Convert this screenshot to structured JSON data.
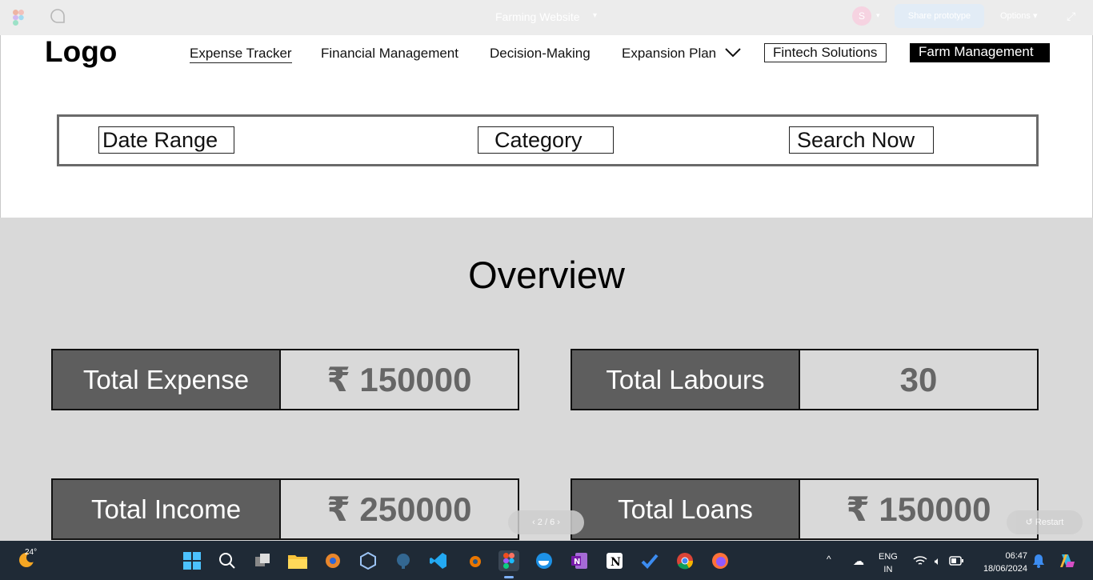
{
  "figma": {
    "file_title": "Farming Website",
    "avatar_initial": "S",
    "share_label": "Share prototype",
    "options_label": "Options",
    "page_indicator": "2 / 6",
    "restart_label": "Restart"
  },
  "header": {
    "logo": "Logo",
    "nav": {
      "expense_tracker": "Expense Tracker",
      "financial_management": "Financial Management",
      "decision_making": "Decision-Making",
      "expansion_plan": "Expansion Plan",
      "fintech_solutions": "Fintech Solutions",
      "farm_management": "Farm Management"
    }
  },
  "filters": {
    "date_range": "Date Range",
    "category": "Category",
    "search_now": "Search Now"
  },
  "overview": {
    "title": "Overview",
    "cards": [
      {
        "label": "Total Expense",
        "value": "₹ 150000"
      },
      {
        "label": "Total Labours",
        "value": "30"
      },
      {
        "label": "Total Income",
        "value": "₹ 250000"
      },
      {
        "label": "Total Loans",
        "value": "₹ 150000"
      }
    ]
  },
  "taskbar": {
    "temperature": "24°",
    "lang_line1": "ENG",
    "lang_line2": "IN",
    "time": "06:47",
    "date": "18/06/2024"
  },
  "colors": {
    "card_label_bg": "#5e5e5e",
    "section_bg": "#d9d9d9",
    "taskbar_bg": "#1f2a36"
  }
}
